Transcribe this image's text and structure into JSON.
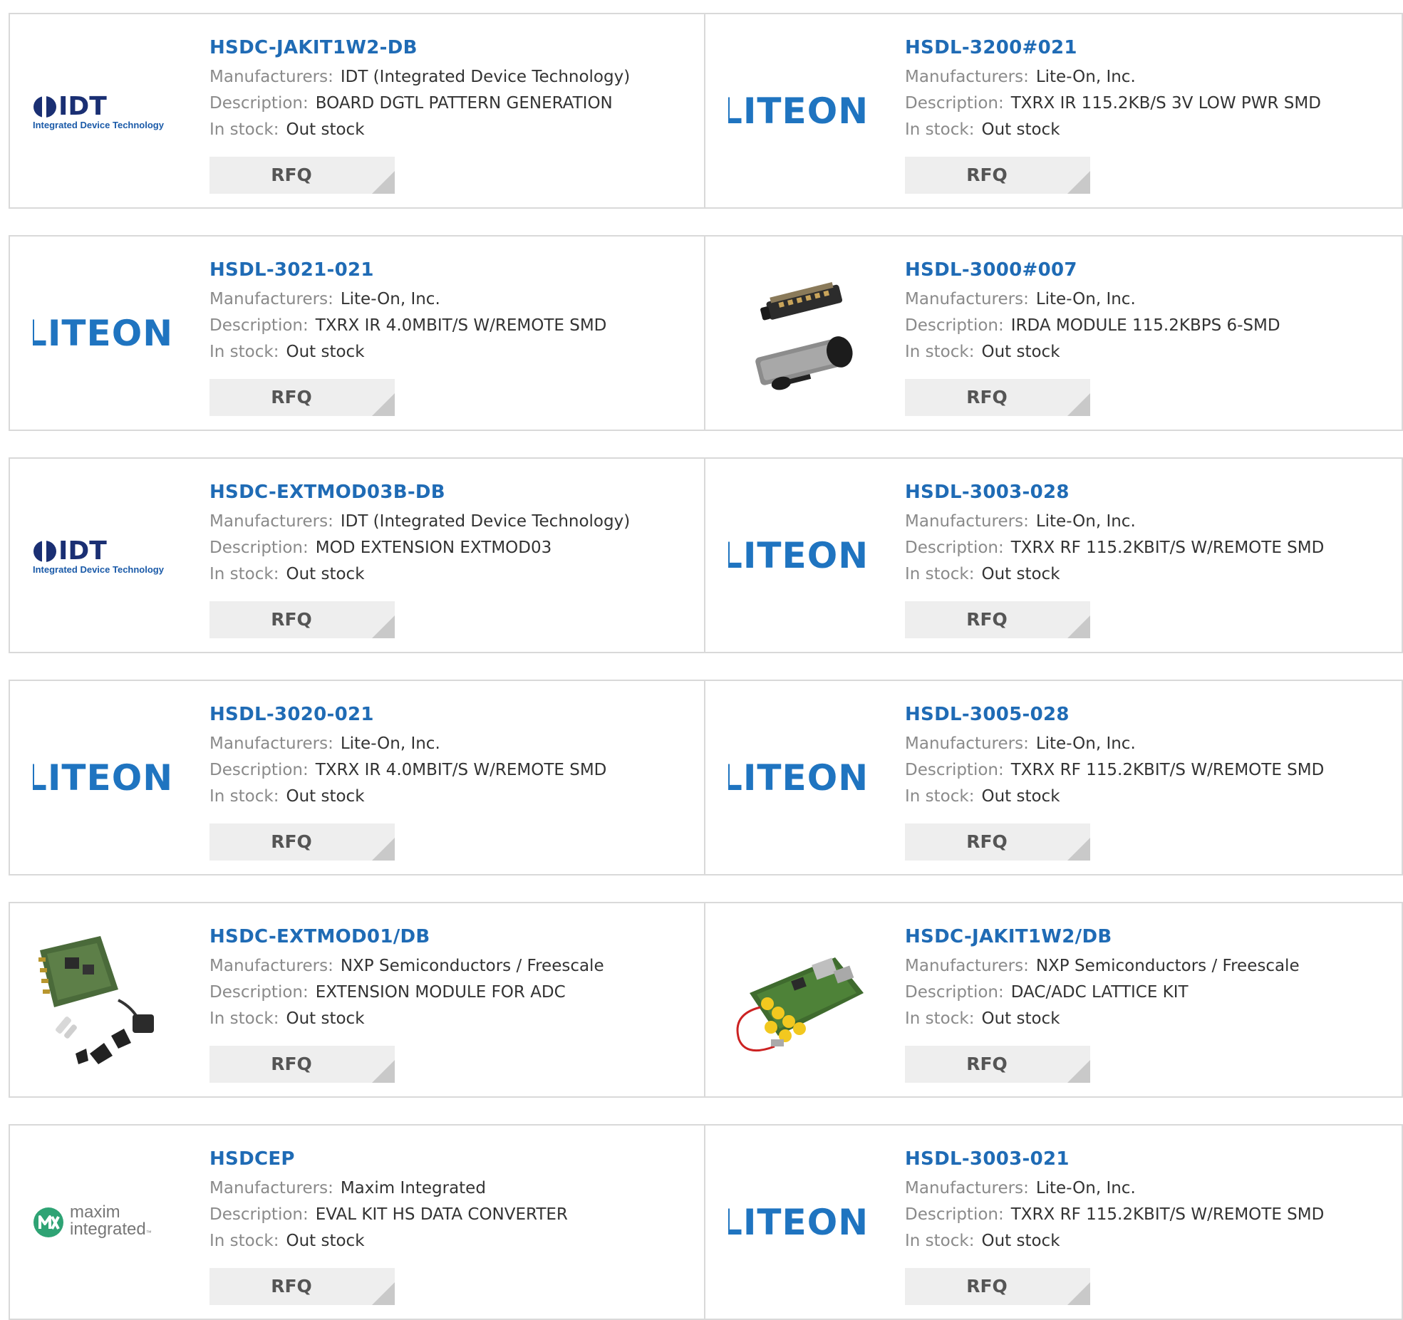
{
  "labels": {
    "manufacturers": "Manufacturers:",
    "description": "Description:",
    "in_stock": "In stock:",
    "rfq": "RFQ"
  },
  "logo_texts": {
    "liteon": "LITEON",
    "idt": "IDT",
    "idt_tagline": "Integrated Device Technology",
    "maxim_line1": "maxim",
    "maxim_line2": "integrated"
  },
  "colors": {
    "link": "#1f6bb5",
    "liteon_blue": "#1f74c0",
    "idt_navy": "#1a2f73",
    "maxim_green": "#2ea374",
    "button_bg": "#eeeeee",
    "border": "#d9d9d9"
  },
  "products": [
    {
      "part_number": "HSDC-JAKIT1W2-DB",
      "manufacturer": "IDT (Integrated Device Technology)",
      "description": "BOARD DGTL PATTERN GENERATION",
      "stock": "Out stock",
      "image": "idt-logo"
    },
    {
      "part_number": "HSDL-3200#021",
      "manufacturer": "Lite-On, Inc.",
      "description": "TXRX IR 115.2KB/S 3V LOW PWR SMD",
      "stock": "Out stock",
      "image": "liteon-logo"
    },
    {
      "part_number": "HSDL-3021-021",
      "manufacturer": "Lite-On, Inc.",
      "description": "TXRX IR 4.0MBIT/S W/REMOTE SMD",
      "stock": "Out stock",
      "image": "liteon-logo"
    },
    {
      "part_number": "HSDL-3000#007",
      "manufacturer": "Lite-On, Inc.",
      "description": "IRDA MODULE 115.2KBPS 6-SMD",
      "stock": "Out stock",
      "image": "irda-module-photo"
    },
    {
      "part_number": "HSDC-EXTMOD03B-DB",
      "manufacturer": "IDT (Integrated Device Technology)",
      "description": "MOD EXTENSION EXTMOD03",
      "stock": "Out stock",
      "image": "idt-logo"
    },
    {
      "part_number": "HSDL-3003-028",
      "manufacturer": "Lite-On, Inc.",
      "description": "TXRX RF 115.2KBIT/S W/REMOTE SMD",
      "stock": "Out stock",
      "image": "liteon-logo"
    },
    {
      "part_number": "HSDL-3020-021",
      "manufacturer": "Lite-On, Inc.",
      "description": "TXRX IR 4.0MBIT/S W/REMOTE SMD",
      "stock": "Out stock",
      "image": "liteon-logo"
    },
    {
      "part_number": "HSDL-3005-028",
      "manufacturer": "Lite-On, Inc.",
      "description": "TXRX RF 115.2KBIT/S W/REMOTE SMD",
      "stock": "Out stock",
      "image": "liteon-logo"
    },
    {
      "part_number": "HSDC-EXTMOD01/DB",
      "manufacturer": "NXP Semiconductors / Freescale",
      "description": "EXTENSION MODULE FOR ADC",
      "stock": "Out stock",
      "image": "extension-module-photo"
    },
    {
      "part_number": "HSDC-JAKIT1W2/DB",
      "manufacturer": "NXP Semiconductors / Freescale",
      "description": "DAC/ADC LATTICE KIT",
      "stock": "Out stock",
      "image": "lattice-kit-photo"
    },
    {
      "part_number": "HSDCEP",
      "manufacturer": "Maxim Integrated",
      "description": "EVAL KIT HS DATA CONVERTER",
      "stock": "Out stock",
      "image": "maxim-logo"
    },
    {
      "part_number": "HSDL-3003-021",
      "manufacturer": "Lite-On, Inc.",
      "description": "TXRX RF 115.2KBIT/S W/REMOTE SMD",
      "stock": "Out stock",
      "image": "liteon-logo"
    }
  ]
}
